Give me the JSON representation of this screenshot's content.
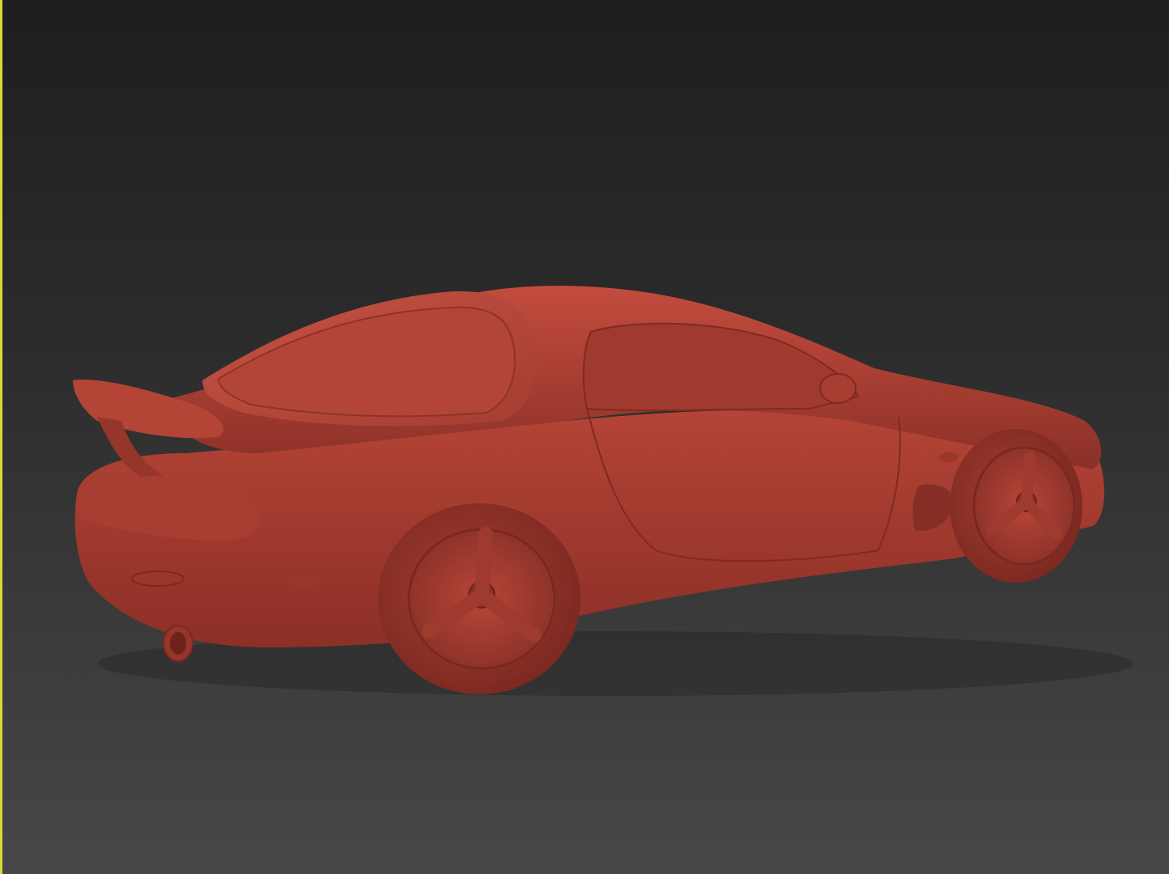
{
  "viewport": {
    "model_color": "#b8483a",
    "active_border_color": "#d8d838",
    "background_top": "#1e1e1e",
    "background_bottom": "#474747"
  }
}
